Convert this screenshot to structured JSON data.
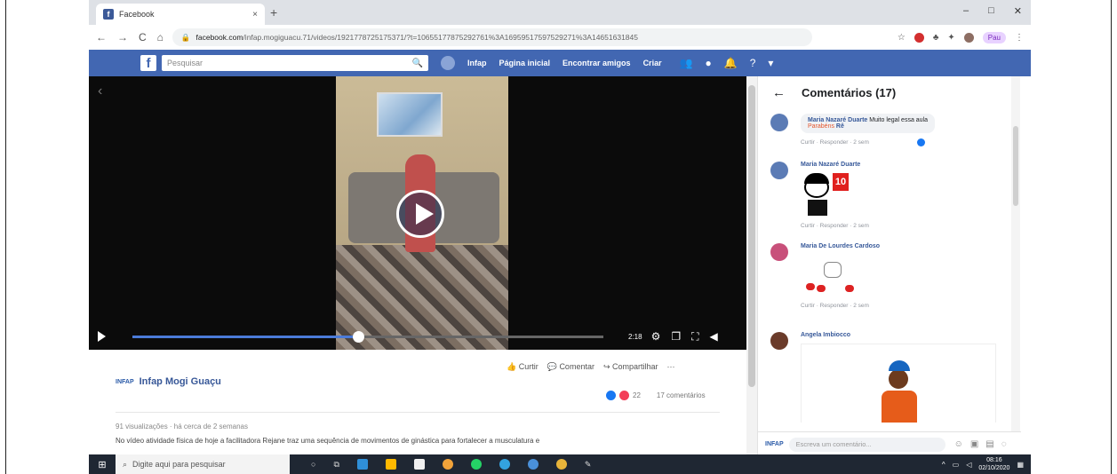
{
  "browser": {
    "tab_title": "Facebook",
    "tab_close": "×",
    "new_tab": "+",
    "window_controls": [
      "–",
      "□",
      "✕"
    ],
    "nav": [
      "←",
      "→",
      "C",
      "⌂"
    ],
    "url_host": "facebook.com",
    "url_path": "/infap.mogiguacu.71/videos/1921778725175371/?t=10655177875292761%3A16959517597529271%3A14651631845",
    "paused_label": "Pau"
  },
  "fb": {
    "logo": "f",
    "search_placeholder": "Pesquisar",
    "profile_name": "Infap",
    "nav_home": "Página inicial",
    "nav_friends": "Encontrar amigos",
    "nav_create": "Criar"
  },
  "video": {
    "progress": 0.48,
    "time": "2:18"
  },
  "post": {
    "action_like": "Curtir",
    "action_comment": "Comentar",
    "action_share": "Compartilhar",
    "more": "···",
    "page_logo": "INFAP",
    "page_name": "Infap Mogi Guaçu",
    "reactions_count": "22",
    "comments_count": "17 comentários",
    "meta": "91 visualizações · há cerca de 2 semanas",
    "description": "No vídeo atividade física de hoje a facilitadora Rejane traz uma sequência de movimentos de ginástica para fortalecer a musculatura e"
  },
  "comments": {
    "title": "Comentários (17)",
    "items": [
      {
        "name": "Maria Nazaré Duarte",
        "text": "Muito legal essa aula",
        "tag": "Parabéns",
        "tag_rest": "Rê",
        "links": "Curtir · Responder · 2 sem"
      },
      {
        "name": "Maria Nazaré Duarte",
        "sticker_text": "10",
        "links": "Curtir · Responder · 2 sem"
      },
      {
        "name": "Maria De Lourdes Cardoso",
        "links": "Curtir · Responder · 2 sem"
      },
      {
        "name": "Angela Imbiocco"
      }
    ],
    "input_placeholder": "Escreva um comentário..."
  },
  "taskbar": {
    "search_placeholder": "Digite aqui para pesquisar",
    "time": "08:16",
    "date": "02/10/2020"
  }
}
